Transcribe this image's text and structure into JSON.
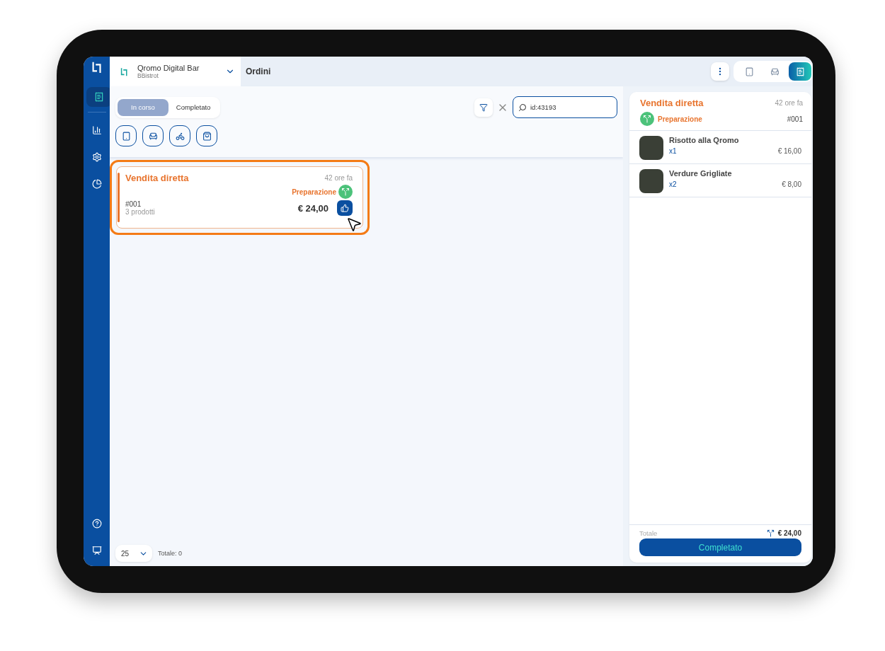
{
  "sidebar": {
    "items": [
      {
        "selected": true
      },
      {
        "selected": false
      },
      {
        "selected": false
      },
      {
        "selected": false
      }
    ]
  },
  "header": {
    "store_name": "Qromo Digital Bar",
    "store_subtitle": "BBistrot",
    "page_title": "Ordini"
  },
  "view_switch": [
    {
      "selected": false
    },
    {
      "selected": false
    },
    {
      "selected": true
    }
  ],
  "status_tabs": [
    {
      "label": "In corso",
      "selected": true
    },
    {
      "label": "Completato",
      "selected": false
    }
  ],
  "search": {
    "value": "id:43193"
  },
  "orders": [
    {
      "title": "Vendita diretta",
      "time": "42 ore fa",
      "status": "Preparazione",
      "number": "#001",
      "products": "3 prodotti",
      "total": "€ 24,00",
      "highlighted": true
    }
  ],
  "pagination": {
    "page_size": "25",
    "total": "Totale: 0"
  },
  "detail": {
    "title": "Vendita diretta",
    "time": "42 ore fa",
    "status": "Preparazione",
    "number": "#001",
    "items": [
      {
        "name": "Risotto alla Qromo",
        "qty": "x1",
        "price": "€ 16,00"
      },
      {
        "name": "Verdure Grigliate",
        "qty": "x2",
        "price": "€ 8,00"
      }
    ],
    "total_label": "Totale",
    "total": "€ 24,00",
    "button": "Completato"
  }
}
